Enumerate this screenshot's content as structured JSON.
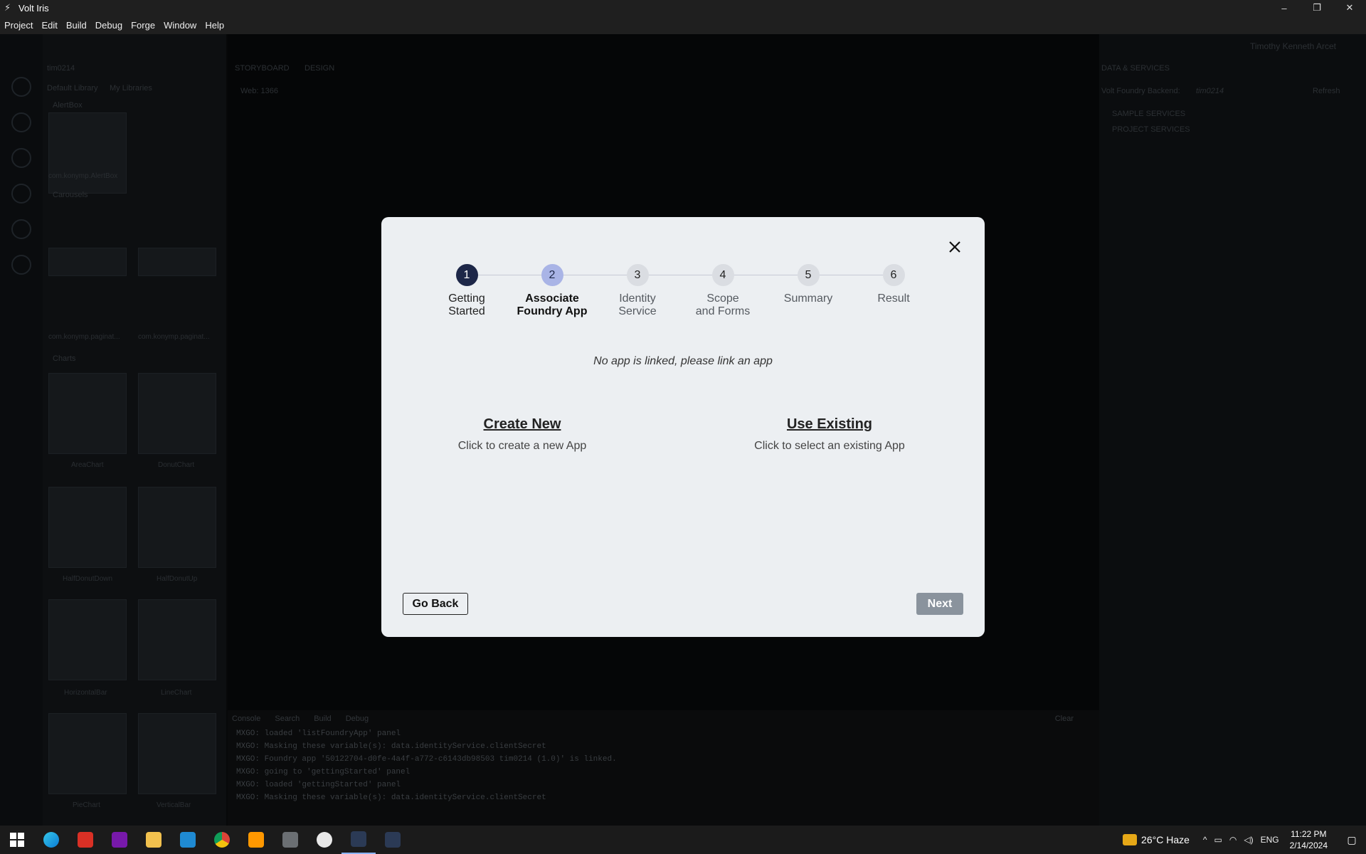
{
  "window": {
    "title": "Volt Iris",
    "minimize": "–",
    "restore": "❐",
    "close": "✕"
  },
  "menu": [
    "Project",
    "Edit",
    "Build",
    "Debug",
    "Forge",
    "Window",
    "Help"
  ],
  "background": {
    "project_name": "tim0214",
    "library_tabs": [
      "Default Library",
      "My Libraries"
    ],
    "canvas_tabs": [
      "STORYBOARD",
      "DESIGN"
    ],
    "channel": "Web: 1366",
    "sections": [
      "AlertBox",
      "Carousels",
      "Charts"
    ],
    "tiles": [
      "com.konymp.AlertBox",
      "com.konymp.paginat...",
      "com.konymp.paginat...",
      "AreaChart",
      "DonutChart",
      "HalfDonutDown",
      "HalfDonutUp",
      "HorizontalBar",
      "LineChart",
      "PieChart",
      "VerticalBar"
    ],
    "user": "Timothy Kenneth Arcet",
    "right_title": "DATA & SERVICES",
    "backend": "Volt Foundry Backend:",
    "backend_app": "tim0214",
    "refresh": "Refresh",
    "services": [
      "SAMPLE SERVICES",
      "PROJECT SERVICES"
    ],
    "console_tabs": [
      "Console",
      "Search",
      "Build",
      "Debug"
    ],
    "console_clear": "Clear",
    "console_lines": [
      "MXGO: loaded 'listFoundryApp' panel",
      "MXGO: Masking these variable(s): data.identityService.clientSecret",
      "MXGO: Foundry app '50122704-d0fe-4a4f-a772-c6143db98503 tim0214 (1.0)' is linked.",
      "MXGO: going to 'gettingStarted' panel",
      "MXGO: loaded 'gettingStarted' panel",
      "MXGO: Masking these variable(s): data.identityService.clientSecret"
    ]
  },
  "wizard": {
    "steps": [
      {
        "num": "1",
        "label": "Getting\nStarted",
        "state": "done"
      },
      {
        "num": "2",
        "label": "Associate\nFoundry App",
        "state": "active"
      },
      {
        "num": "3",
        "label": "Identity\nService",
        "state": "pending"
      },
      {
        "num": "4",
        "label": "Scope\nand Forms",
        "state": "pending"
      },
      {
        "num": "5",
        "label": "Summary",
        "state": "pending"
      },
      {
        "num": "6",
        "label": "Result",
        "state": "pending"
      }
    ],
    "message": "No app is linked, please link an app",
    "create": {
      "title": "Create New",
      "desc": "Click to create a new App"
    },
    "existing": {
      "title": "Use Existing",
      "desc": "Click to select an existing App"
    },
    "back_label": "Go Back",
    "next_label": "Next"
  },
  "taskbar": {
    "apps": [
      "start-icon",
      "edge-icon",
      "gmail-icon",
      "onenote-icon",
      "file-explorer-icon",
      "vscode-icon",
      "chrome-icon",
      "sublime-icon",
      "calculator-icon",
      "paint-icon",
      "volt-iris-icon",
      "volt-iris-icon"
    ],
    "weather": "26°C  Haze",
    "lang": "ENG",
    "time": "11:22 PM",
    "date": "2/14/2024"
  }
}
